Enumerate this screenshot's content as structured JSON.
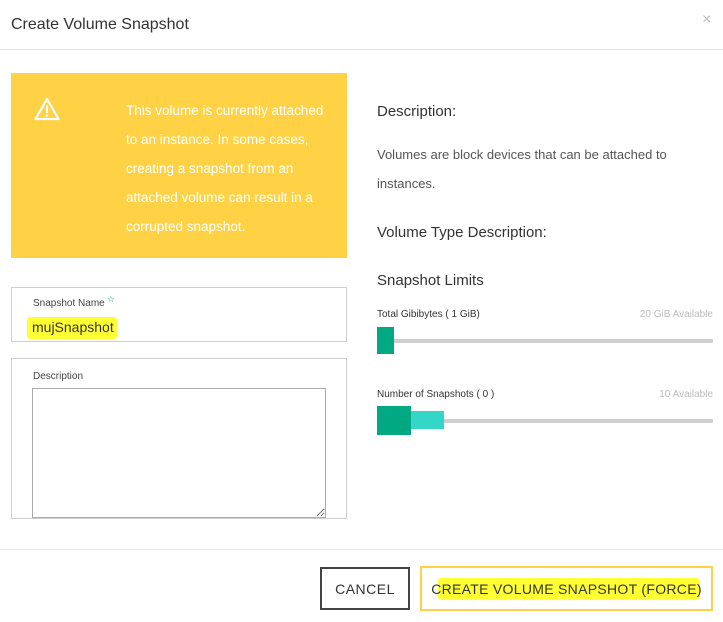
{
  "modal": {
    "title": "Create Volume Snapshot",
    "close_glyph": "×"
  },
  "warning": {
    "icon": "warning-triangle-icon",
    "text": "This volume is currently attached to an instance. In some cases, creating a snapshot from an attached volume can result in a corrupted snapshot."
  },
  "form": {
    "snapshot_name_label": "Snapshot Name",
    "required_marker": "☆",
    "snapshot_name_value": "mujSnapshot",
    "description_label": "Description",
    "description_value": ""
  },
  "info": {
    "description_heading": "Description:",
    "description_text": "Volumes are block devices that can be attached to instances.",
    "volume_type_heading": "Volume Type Description:",
    "limits_heading": "Snapshot Limits"
  },
  "limits": [
    {
      "label": "Total Gibibytes ( 1 GiB)",
      "available": "20 GiB Available",
      "used_fraction": 0.05
    },
    {
      "label": "Number of Snapshots ( 0 )",
      "available": "10 Available",
      "used_fraction": 0.0,
      "adding_fraction": 0.1
    }
  ],
  "buttons": {
    "cancel": "CANCEL",
    "create": "CREATE VOLUME SNAPSHOT (FORCE)"
  },
  "colors": {
    "warning_bg": "#ffd144",
    "progress_used": "#00a982",
    "progress_adding": "#33d6c7",
    "highlight": "#ffff33"
  }
}
